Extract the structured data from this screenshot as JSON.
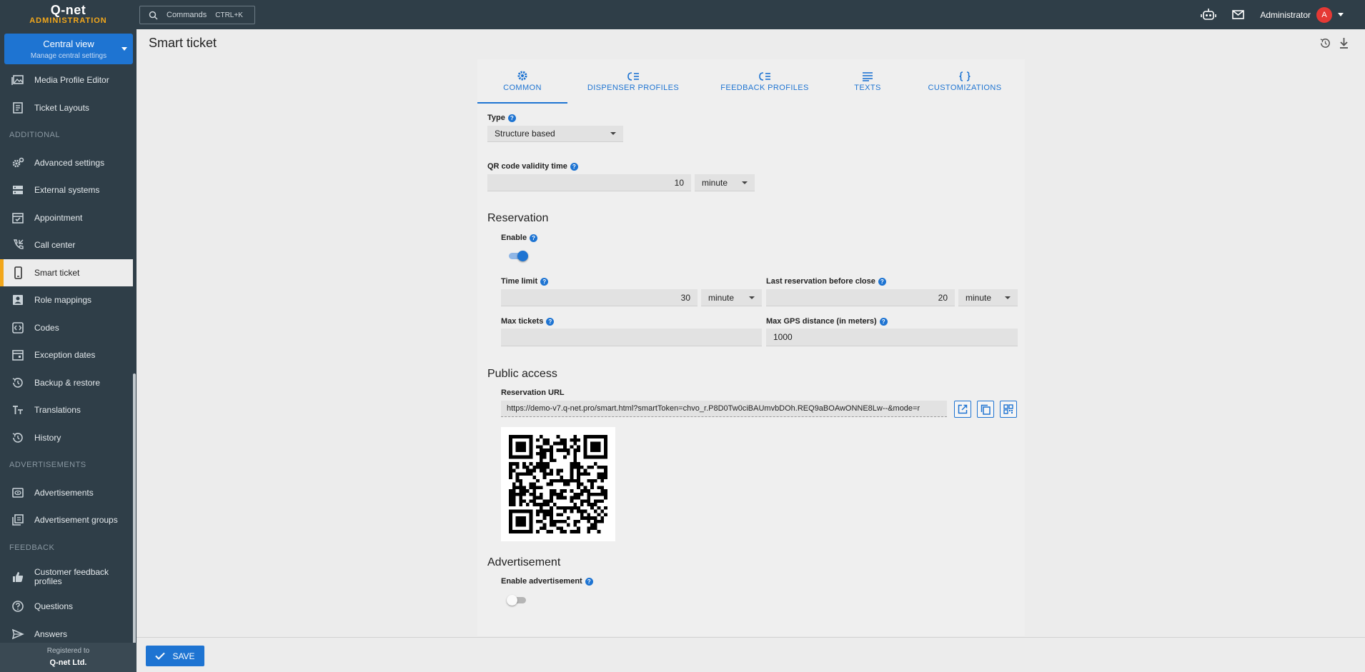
{
  "app": {
    "brand": "Q-net",
    "subtitle": "ADMINISTRATION"
  },
  "search": {
    "label": "Commands",
    "shortcut": "CTRL+K"
  },
  "topbar": {
    "user": "Administrator",
    "avatar_letter": "A"
  },
  "central": {
    "title": "Central view",
    "subtitle": "Manage central settings"
  },
  "sidebar": {
    "items": [
      {
        "label": "Media Profile Editor"
      },
      {
        "label": "Ticket Layouts"
      },
      {
        "section": "ADDITIONAL"
      },
      {
        "label": "Advanced settings"
      },
      {
        "label": "External systems"
      },
      {
        "label": "Appointment"
      },
      {
        "label": "Call center"
      },
      {
        "label": "Smart ticket",
        "active": true
      },
      {
        "label": "Role mappings"
      },
      {
        "label": "Codes"
      },
      {
        "label": "Exception dates"
      },
      {
        "label": "Backup & restore"
      },
      {
        "label": "Translations"
      },
      {
        "label": "History"
      },
      {
        "section": "ADVERTISEMENTS"
      },
      {
        "label": "Advertisements"
      },
      {
        "label": "Advertisement groups"
      },
      {
        "section": "FEEDBACK"
      },
      {
        "label": "Customer feedback profiles"
      },
      {
        "label": "Questions"
      },
      {
        "label": "Answers"
      }
    ],
    "registered_label": "Registered to",
    "registered_company": "Q-net Ltd."
  },
  "page": {
    "title": "Smart ticket"
  },
  "tabs": [
    {
      "label": "COMMON",
      "icon": "gear-icon",
      "active": true
    },
    {
      "label": "DISPENSER PROFILES",
      "icon": "list-icon"
    },
    {
      "label": "FEEDBACK PROFILES",
      "icon": "list-icon"
    },
    {
      "label": "TEXTS",
      "icon": "lines-icon"
    },
    {
      "label": "CUSTOMIZATIONS",
      "icon": "braces-icon"
    }
  ],
  "form": {
    "type_label": "Type",
    "type_value": "Structure based",
    "qr_label": "QR code validity time",
    "qr_value": "10",
    "qr_unit": "minute",
    "reservation_header": "Reservation",
    "enable_label": "Enable",
    "enable_on": true,
    "time_limit_label": "Time limit",
    "time_limit_value": "30",
    "time_limit_unit": "minute",
    "last_res_label": "Last reservation before close",
    "last_res_value": "20",
    "last_res_unit": "minute",
    "max_tickets_label": "Max tickets",
    "max_tickets_value": "",
    "max_gps_label": "Max GPS distance (in meters)",
    "max_gps_value": "1000",
    "public_header": "Public access",
    "url_label": "Reservation URL",
    "url_value": "https://demo-v7.q-net.pro/smart.html?smartToken=chvo_r.P8D0Tw0ciBAUmvbDOh.REQ9aBOAwONNE8Lw--&mode=r",
    "adv_header": "Advertisement",
    "enable_adv_label": "Enable advertisement",
    "enable_adv_on": false
  },
  "save_label": "SAVE"
}
